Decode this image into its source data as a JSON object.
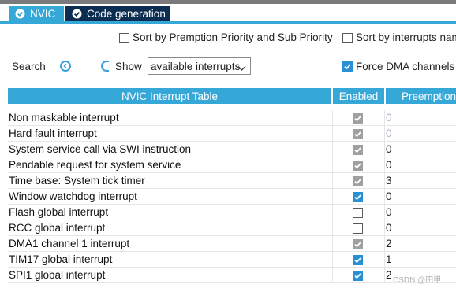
{
  "tabs": [
    {
      "label": "NVIC",
      "active": true
    },
    {
      "label": "Code generation",
      "active": false
    }
  ],
  "options": {
    "sort_premption_label": "Sort by Premption Priority and Sub Priority",
    "sort_interrupts_label": "Sort by interrupts nam",
    "search_label": "Search",
    "show_label": "Show",
    "show_value": "available interrupts",
    "force_dma_label": "Force DMA channels"
  },
  "table": {
    "title": "NVIC Interrupt Table",
    "col_enabled": "Enabled",
    "col_preemption": "Preemption",
    "rows": [
      {
        "name": "Non maskable interrupt",
        "enabled": "checked-locked",
        "priority": "0",
        "priority_editable": false
      },
      {
        "name": "Hard fault interrupt",
        "enabled": "checked-locked",
        "priority": "0",
        "priority_editable": false
      },
      {
        "name": "System service call via SWI instruction",
        "enabled": "checked-locked",
        "priority": "0",
        "priority_editable": true
      },
      {
        "name": "Pendable request for system service",
        "enabled": "checked-locked",
        "priority": "0",
        "priority_editable": true
      },
      {
        "name": "Time base: System tick timer",
        "enabled": "checked-locked",
        "priority": "3",
        "priority_editable": true
      },
      {
        "name": "Window watchdog interrupt",
        "enabled": "checked",
        "priority": "0",
        "priority_editable": true
      },
      {
        "name": "Flash global interrupt",
        "enabled": "unchecked",
        "priority": "0",
        "priority_editable": true
      },
      {
        "name": "RCC global interrupt",
        "enabled": "unchecked",
        "priority": "0",
        "priority_editable": true
      },
      {
        "name": "DMA1 channel 1 interrupt",
        "enabled": "checked-locked",
        "priority": "2",
        "priority_editable": true
      },
      {
        "name": "TIM17 global interrupt",
        "enabled": "checked",
        "priority": "1",
        "priority_editable": true
      },
      {
        "name": "SPI1 global interrupt",
        "enabled": "checked",
        "priority": "2",
        "priority_editable": true
      }
    ]
  },
  "watermark": "CSDN @田甲",
  "colors": {
    "accent": "#36a8d8",
    "tab_inactive": "#0c2d52",
    "checkbox_checked": "#2a90d4",
    "checkbox_locked": "#a0a0a0"
  },
  "icons": [
    "check-circle-icon",
    "nav-prev-icon",
    "nav-next-icon",
    "chevron-down-icon",
    "checkmark-icon"
  ]
}
